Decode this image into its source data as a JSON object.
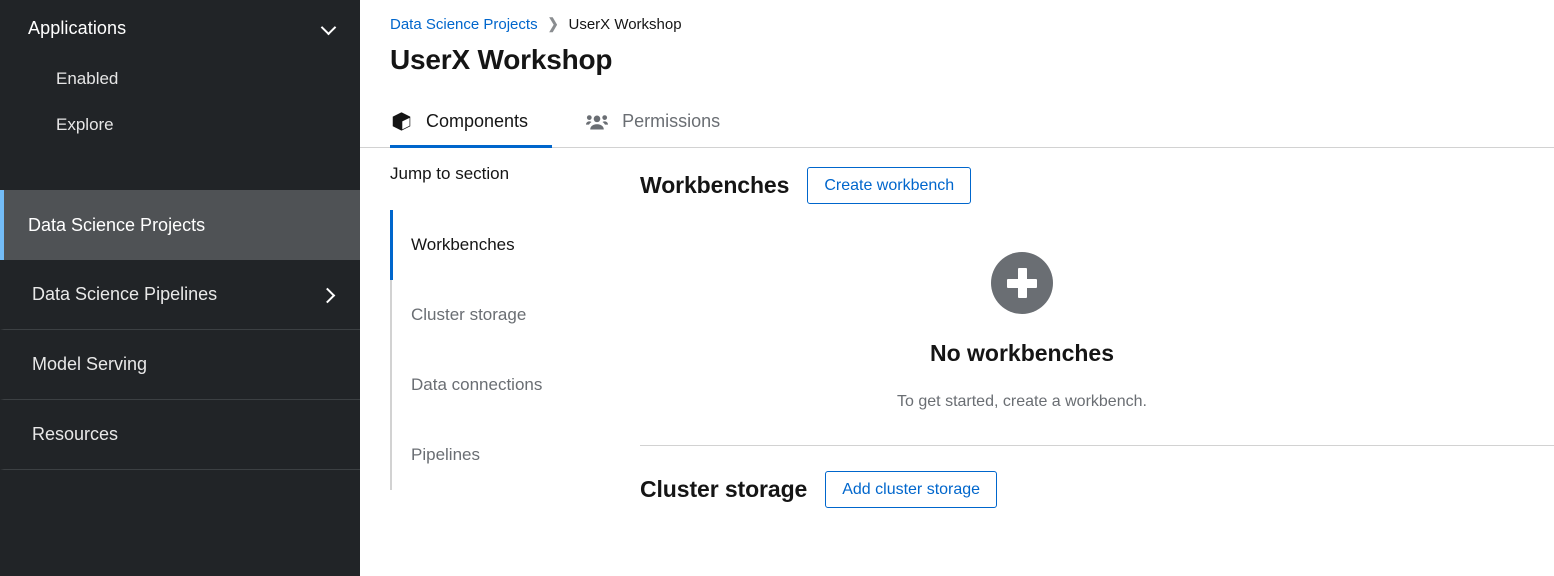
{
  "sidebar": {
    "group": {
      "label": "Applications",
      "icon": "chevron-down-icon",
      "expanded": true
    },
    "sub_items": [
      {
        "label": "Enabled"
      },
      {
        "label": "Explore"
      }
    ],
    "items": [
      {
        "label": "Data Science Projects",
        "active": true,
        "icon": null
      },
      {
        "label": "Data Science Pipelines",
        "active": false,
        "icon": "chevron-right-icon"
      },
      {
        "label": "Model Serving",
        "active": false,
        "icon": null
      },
      {
        "label": "Resources",
        "active": false,
        "icon": null
      }
    ],
    "colors": {
      "background": "#212427",
      "active_background": "#4f5255",
      "active_border": "#73bcf7"
    }
  },
  "breadcrumb": {
    "parent": "Data Science Projects",
    "separator": "❯",
    "current": "UserX Workshop"
  },
  "page": {
    "title": "UserX Workshop"
  },
  "tabs": [
    {
      "label": "Components",
      "icon": "cube-icon",
      "active": true
    },
    {
      "label": "Permissions",
      "icon": "users-icon",
      "active": false
    }
  ],
  "jump_to_section": {
    "title": "Jump to section",
    "items": [
      {
        "label": "Workbenches",
        "active": true
      },
      {
        "label": "Cluster storage",
        "active": false
      },
      {
        "label": "Data connections",
        "active": false
      },
      {
        "label": "Pipelines",
        "active": false
      }
    ]
  },
  "sections": [
    {
      "title": "Workbenches",
      "action_label": "Create workbench",
      "empty_state": {
        "icon": "plus-circle-icon",
        "title": "No workbenches",
        "body": "To get started, create a workbench."
      }
    },
    {
      "title": "Cluster storage",
      "action_label": "Add cluster storage"
    }
  ],
  "colors": {
    "link": "#0066cc",
    "text": "#151515",
    "muted": "#6a6e73",
    "border": "#d2d2d2"
  }
}
